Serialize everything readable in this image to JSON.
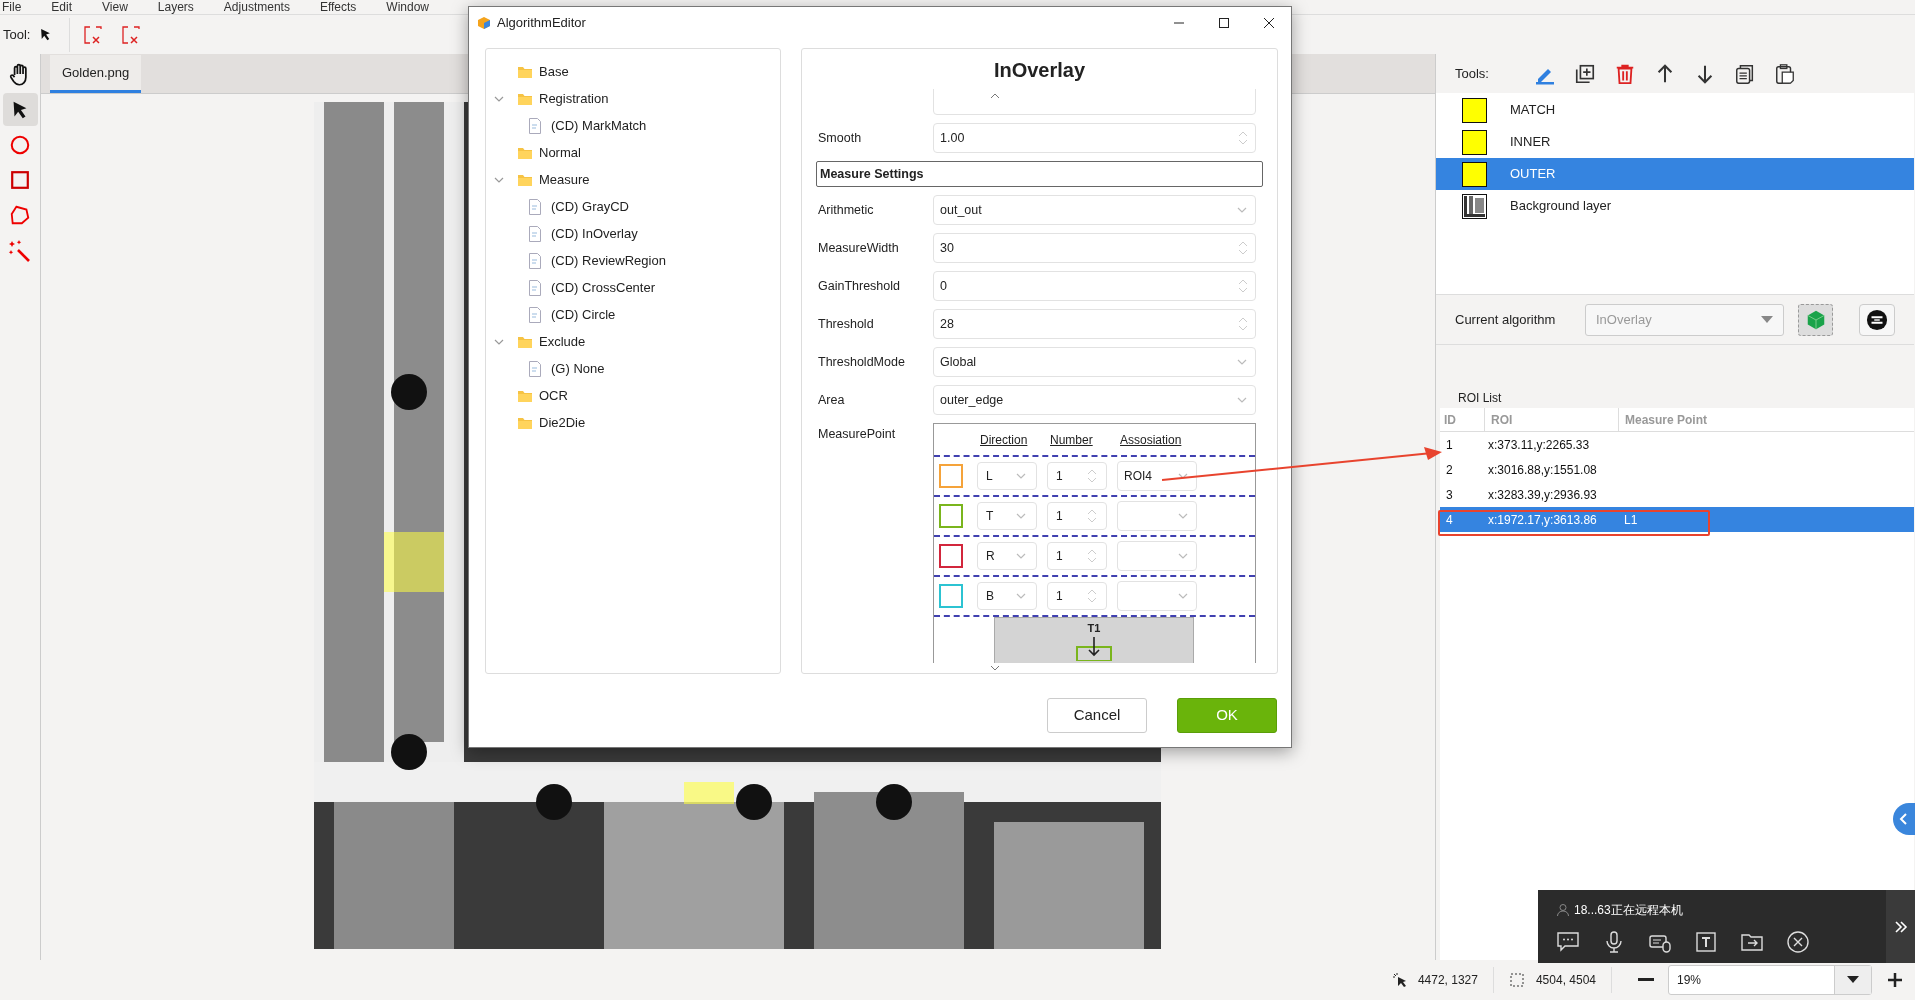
{
  "menu": [
    "File",
    "Edit",
    "View",
    "Layers",
    "Adjustments",
    "Effects",
    "Window"
  ],
  "toolbar": {
    "label": "Tool:"
  },
  "tools": [
    {
      "kind": "hand",
      "selected": false
    },
    {
      "kind": "pointer",
      "selected": true
    },
    {
      "kind": "circle",
      "selected": false
    },
    {
      "kind": "square",
      "selected": false
    },
    {
      "kind": "polygon",
      "selected": false
    },
    {
      "kind": "wand",
      "selected": false
    }
  ],
  "document_tabs": [
    {
      "label": "Golden.png",
      "selected": true
    }
  ],
  "dialog": {
    "title": "AlgorithmEditor",
    "tree": [
      {
        "label": "Base",
        "kind": "folder"
      },
      {
        "label": "Registration",
        "kind": "folder",
        "expanded": true,
        "children": [
          {
            "label": "(CD) MarkMatch",
            "kind": "file"
          }
        ]
      },
      {
        "label": "Normal",
        "kind": "folder"
      },
      {
        "label": "Measure",
        "kind": "folder",
        "expanded": true,
        "children": [
          {
            "label": "(CD) GrayCD",
            "kind": "file"
          },
          {
            "label": "(CD) InOverlay",
            "kind": "file"
          },
          {
            "label": "(CD) ReviewRegion",
            "kind": "file"
          },
          {
            "label": "(CD) CrossCenter",
            "kind": "file"
          },
          {
            "label": "(CD) Circle",
            "kind": "file"
          }
        ]
      },
      {
        "label": "Exclude",
        "kind": "folder",
        "expanded": true,
        "children": [
          {
            "label": "(G) None",
            "kind": "file"
          }
        ]
      },
      {
        "label": "OCR",
        "kind": "folder"
      },
      {
        "label": "Die2Die",
        "kind": "folder"
      }
    ],
    "panel_title": "InOverlay",
    "fields_before": [
      {
        "label": "Smooth",
        "value": "1.00",
        "kind": "spin"
      }
    ],
    "section": "Measure Settings",
    "fields": [
      {
        "label": "Arithmetic",
        "value": "out_out",
        "kind": "select"
      },
      {
        "label": "MeasureWidth",
        "value": "30",
        "kind": "spin"
      },
      {
        "label": "GainThreshold",
        "value": "0",
        "kind": "spin"
      },
      {
        "label": "Threshold",
        "value": "28",
        "kind": "spin"
      },
      {
        "label": "ThresholdMode",
        "value": "Global",
        "kind": "select"
      },
      {
        "label": "Area",
        "value": "outer_edge",
        "kind": "select"
      }
    ],
    "measure_point": {
      "label": "MeasurePoint",
      "columns": [
        "Direction",
        "Number",
        "Assosiation"
      ],
      "rows": [
        {
          "color": "#f5a33a",
          "direction": "L",
          "number": "1",
          "association": "ROI4"
        },
        {
          "color": "#7ab51d",
          "direction": "T",
          "number": "1"
        },
        {
          "color": "#d2263c",
          "direction": "R",
          "number": "1"
        },
        {
          "color": "#2cc3d2",
          "direction": "B",
          "number": "1"
        }
      ],
      "preview_label": "T1"
    },
    "buttons": [
      {
        "label": "Cancel",
        "kind": "secondary"
      },
      {
        "label": "OK",
        "kind": "primary"
      }
    ]
  },
  "layers_panel": {
    "tools_label": "Tools:",
    "layers": [
      {
        "name": "MATCH",
        "kind": "fill",
        "selected": false
      },
      {
        "name": "INNER",
        "kind": "fill",
        "selected": false
      },
      {
        "name": "OUTER",
        "kind": "fill",
        "selected": true
      },
      {
        "name": "Background layer",
        "selected": false
      }
    ],
    "current_algorithm": {
      "label": "Current algorithm",
      "value": "InOverlay"
    }
  },
  "roi_list": {
    "title": "ROI List",
    "columns": [
      "ID",
      "ROI",
      "Measure Point"
    ],
    "rows": [
      {
        "id": "1",
        "roi": "x:373.11,y:2265.33",
        "selected": false
      },
      {
        "id": "2",
        "roi": "x:3016.88,y:1551.08",
        "selected": false
      },
      {
        "id": "3",
        "roi": "x:3283.39,y:2936.93",
        "selected": false
      },
      {
        "id": "4",
        "roi": "x:1972.17,y:3613.86",
        "measure_point": "L1",
        "selected": true
      }
    ]
  },
  "status_bar": {
    "cursor": "4472, 1327",
    "selection": "4504, 4504",
    "zoom": "19%"
  },
  "remote_bar": {
    "text": "18...63正在远程本机"
  }
}
